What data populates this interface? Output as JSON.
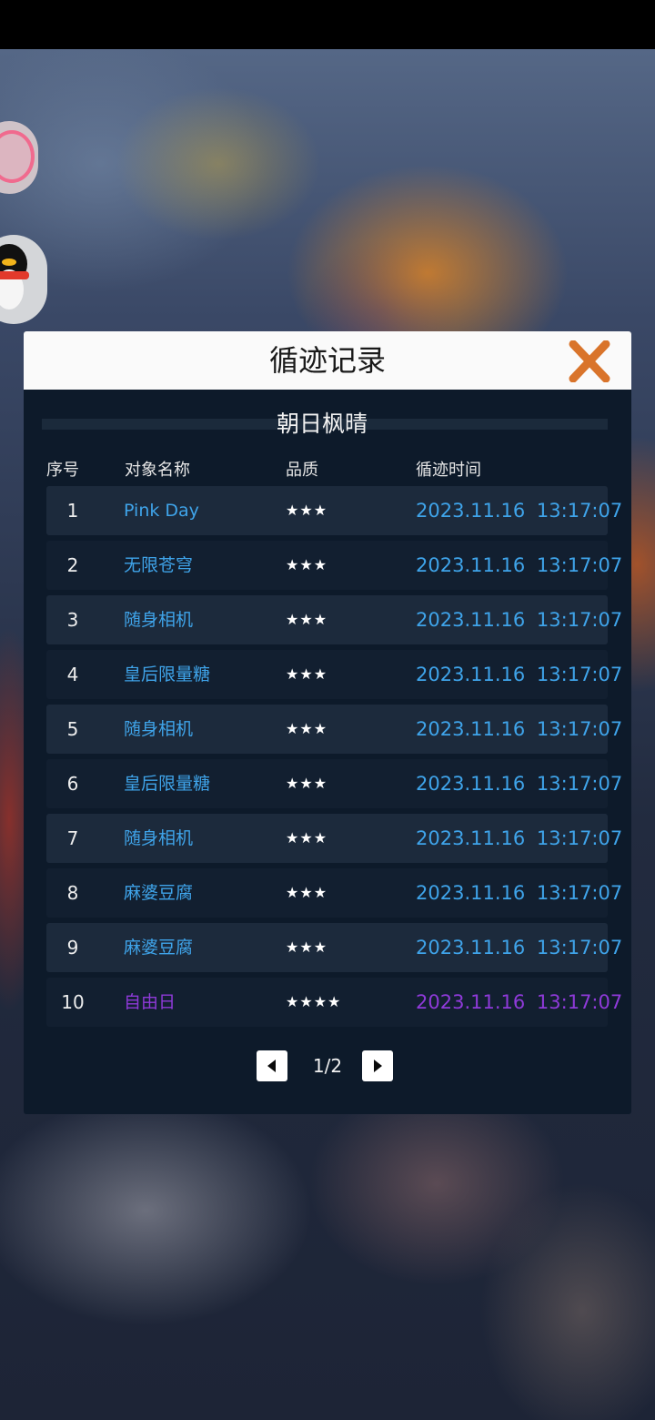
{
  "dialog": {
    "title": "循迹记录",
    "close_icon": "close-x-icon",
    "section_title": "朝日枫晴",
    "columns": [
      "序号",
      "对象名称",
      "品质",
      "循迹时间"
    ],
    "accent_colors": {
      "name": "#3fa4ea",
      "rare": "#8f3ad9",
      "close": "#d9742b"
    },
    "rows": [
      {
        "idx": "1",
        "name": "Pink Day",
        "stars": "★★★",
        "time": "2023.11.16 13:17:07"
      },
      {
        "idx": "2",
        "name": "无限苍穹",
        "stars": "★★★",
        "time": "2023.11.16 13:17:07"
      },
      {
        "idx": "3",
        "name": "随身相机",
        "stars": "★★★",
        "time": "2023.11.16 13:17:07"
      },
      {
        "idx": "4",
        "name": "皇后限量糖",
        "stars": "★★★",
        "time": "2023.11.16 13:17:07"
      },
      {
        "idx": "5",
        "name": "随身相机",
        "stars": "★★★",
        "time": "2023.11.16 13:17:07"
      },
      {
        "idx": "6",
        "name": "皇后限量糖",
        "stars": "★★★",
        "time": "2023.11.16 13:17:07"
      },
      {
        "idx": "7",
        "name": "随身相机",
        "stars": "★★★",
        "time": "2023.11.16 13:17:07"
      },
      {
        "idx": "8",
        "name": "麻婆豆腐",
        "stars": "★★★",
        "time": "2023.11.16 13:17:07"
      },
      {
        "idx": "9",
        "name": "麻婆豆腐",
        "stars": "★★★",
        "time": "2023.11.16 13:17:07"
      },
      {
        "idx": "10",
        "name": "自由日",
        "stars": "★★★★",
        "time": "2023.11.16 13:17:07"
      }
    ],
    "pagination": {
      "label": "1/2",
      "prev_icon": "triangle-left-icon",
      "next_icon": "triangle-right-icon"
    }
  },
  "side": {
    "avatar1_icon": "pig-avatar-icon",
    "avatar2_icon": "qq-penguin-icon"
  }
}
